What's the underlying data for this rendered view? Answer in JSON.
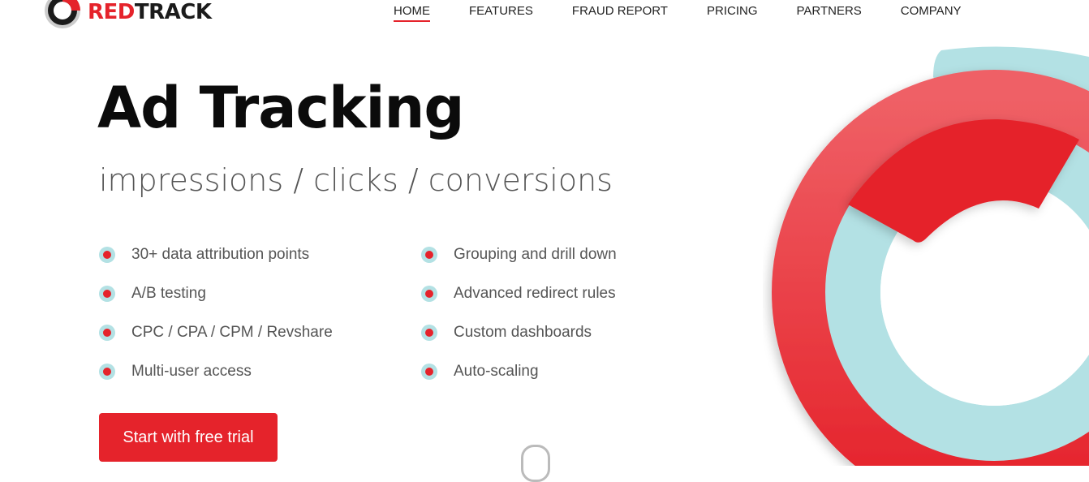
{
  "brand": {
    "name_red": "RED",
    "name_dark": "TRACK",
    "accent": "#e5232b",
    "teal": "#b3e1e4"
  },
  "nav": {
    "items": [
      {
        "label": "HOME",
        "active": true
      },
      {
        "label": "FEATURES"
      },
      {
        "label": "FRAUD REPORT"
      },
      {
        "label": "PRICING"
      },
      {
        "label": "PARTNERS"
      },
      {
        "label": "COMPANY"
      }
    ]
  },
  "hero": {
    "title": "Ad Tracking",
    "subtitle": "impressions / clicks / conversions",
    "features_left": [
      "30+ data attribution points",
      "A/B testing",
      "CPC / CPA / CPM / Revshare",
      "Multi-user access"
    ],
    "features_right": [
      "Grouping and drill down",
      "Advanced redirect rules",
      "Custom dashboards",
      "Auto-scaling"
    ],
    "cta_label": "Start with free trial"
  }
}
